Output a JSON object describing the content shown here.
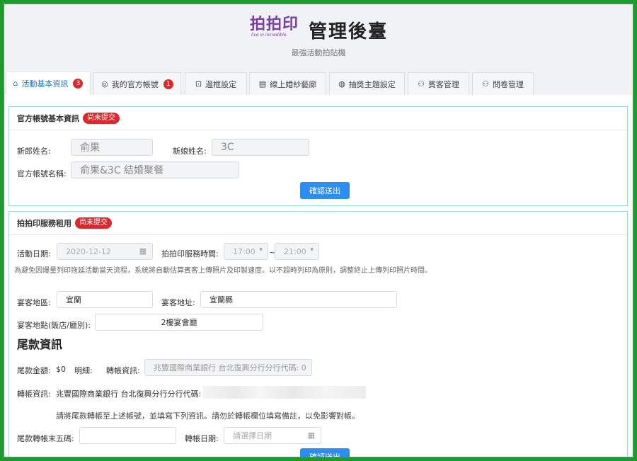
{
  "header": {
    "logo_text": "拍拍印",
    "logo_tagline": "live in incredible.",
    "title": "管理後臺",
    "subtitle": "最強活動拍貼機"
  },
  "tabs": [
    {
      "label": "活動基本資訊",
      "icon": "home-icon",
      "badge": "3",
      "active": true
    },
    {
      "label": "我的官方帳號",
      "icon": "globe-icon",
      "badge": "1",
      "active": false
    },
    {
      "label": "邊框設定",
      "icon": "frame-icon",
      "badge": "",
      "active": false
    },
    {
      "label": "線上婚紗藝廊",
      "icon": "document-icon",
      "badge": "",
      "active": false
    },
    {
      "label": "抽獎主題設定",
      "icon": "apple-icon",
      "badge": "",
      "active": false
    },
    {
      "label": "賓客管理",
      "icon": "users-icon",
      "badge": "",
      "active": false
    },
    {
      "label": "問卷管理",
      "icon": "users-icon",
      "badge": "",
      "active": false
    }
  ],
  "official_account": {
    "heading": "官方帳號基本資訊",
    "status": "尚未提交",
    "groom_label": "新郎姓名:",
    "groom_value": "俞果",
    "bride_label": "新娘姓名:",
    "bride_value": "3C",
    "account_label": "官方帳號名稱:",
    "account_value": "俞果&3C 結婚聚餐",
    "submit": "確認送出"
  },
  "rental": {
    "heading": "拍拍印服務租用",
    "status": "尚未提交",
    "date_label": "活動日期:",
    "date_value": "2020-12-12",
    "time_label": "拍拍印服務時間:",
    "time_start": "17:00",
    "time_sep": "~",
    "time_end": "21:00",
    "note": "為避免因爆量列印拖延活動當天流程，系統將自動估算賓客上傳照片及印製速度。以不超時列印為原則，調整終止上傳列印照片時間。",
    "region_label": "宴客地區:",
    "region_value": "宜蘭",
    "address_label": "宴客地址:",
    "address_value": "宜蘭縣",
    "venue_label": "宴客地點(飯店/廳別):",
    "venue_value": "2樓宴會廳"
  },
  "balance": {
    "heading": "尾款資訊",
    "amount_label": "尾款金額:",
    "amount_value": "$0",
    "detail_label": "明細:",
    "transfer_label": "轉帳資訊:",
    "transfer_field": "兆豐國際商業銀行 台北復興分行分行代碼: 0",
    "transfer_info_label": "轉帳資訊:",
    "transfer_info_value": "兆豐國際商業銀行 台北復興分行分行代碼:",
    "instruction": "請將尾款轉帳至上述帳號，並填寫下列資訊。請勿於轉帳欄位填寫備註，以免影響對帳。",
    "last5_label": "尾款轉帳末五碼:",
    "last5_value": "",
    "transfer_date_label": "轉帳日期:",
    "transfer_date_placeholder": "請選擇日期",
    "submit": "確認送出"
  }
}
